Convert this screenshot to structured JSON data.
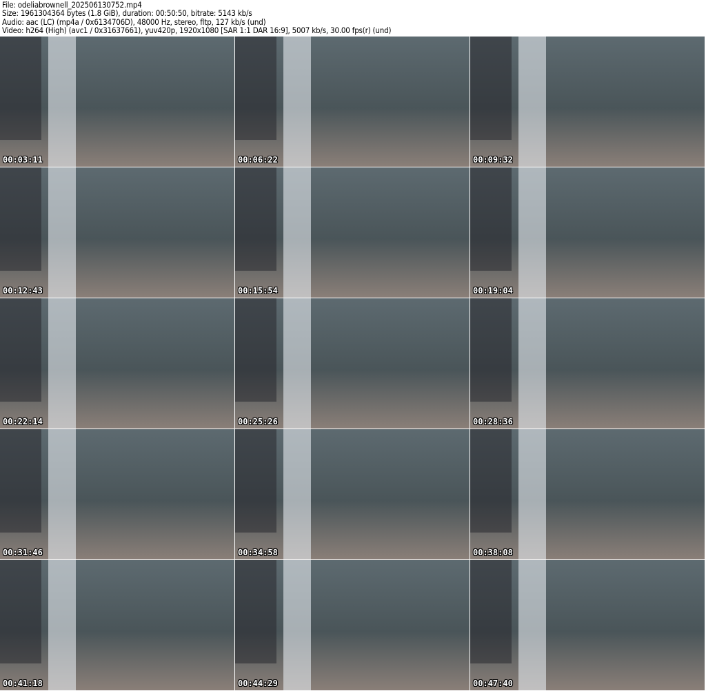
{
  "header": {
    "file": "File: odeliabrownell_202506130752.mp4",
    "size": "Size: 1961304364 bytes (1.8 GiB), duration: 00:50:50, bitrate: 5143 kb/s",
    "audio": "Audio: aac (LC) (mp4a / 0x6134706D), 48000 Hz, stereo, fltp, 127 kb/s (und)",
    "video": "Video: h264 (High) (avc1 / 0x31637661), yuv420p, 1920x1080 [SAR 1:1 DAR 16:9], 5007 kb/s, 30.00 fps(r) (und)"
  },
  "thumbnails": [
    "00:03:11",
    "00:06:22",
    "00:09:32",
    "00:12:43",
    "00:15:54",
    "00:19:04",
    "00:22:14",
    "00:25:26",
    "00:28:36",
    "00:31:46",
    "00:34:58",
    "00:38:08",
    "00:41:18",
    "00:44:29",
    "00:47:40"
  ]
}
